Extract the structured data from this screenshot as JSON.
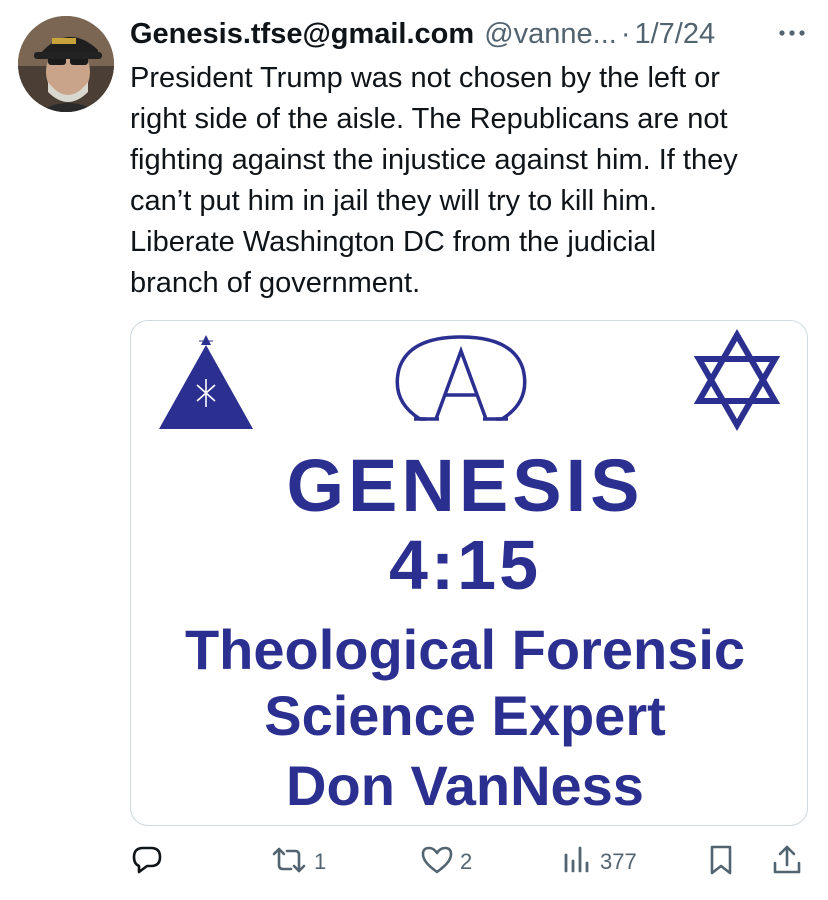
{
  "tweet": {
    "author_name": "Genesis.tfse@gmail.com",
    "handle": "@vanne...",
    "separator": "·",
    "date": "1/7/24",
    "text": "President Trump was not chosen by the left or\nright side of the aisle. The Republicans are not\nfighting against the injustice against him. If they\ncan’t put him in jail they will try to kill him.\nLiberate Washington DC from the judicial\nbranch of government."
  },
  "media": {
    "line1": "GENESIS",
    "line2": "4:15",
    "line3": "Theological Forensic",
    "line4": "Science Expert",
    "line5": "Don VanNess",
    "text_color": "#2b2f8f"
  },
  "actions": {
    "reply_icon": "reply-icon",
    "retweet_icon": "retweet-icon",
    "retweet_count": "1",
    "like_icon": "heart-icon",
    "like_count": "2",
    "views_icon": "views-chart-icon",
    "views_count": "377",
    "bookmark_icon": "bookmark-icon",
    "share_icon": "share-icon"
  },
  "colors": {
    "secondary_text": "#536471",
    "border": "#cfd9de",
    "primary_text": "#0f1419"
  }
}
